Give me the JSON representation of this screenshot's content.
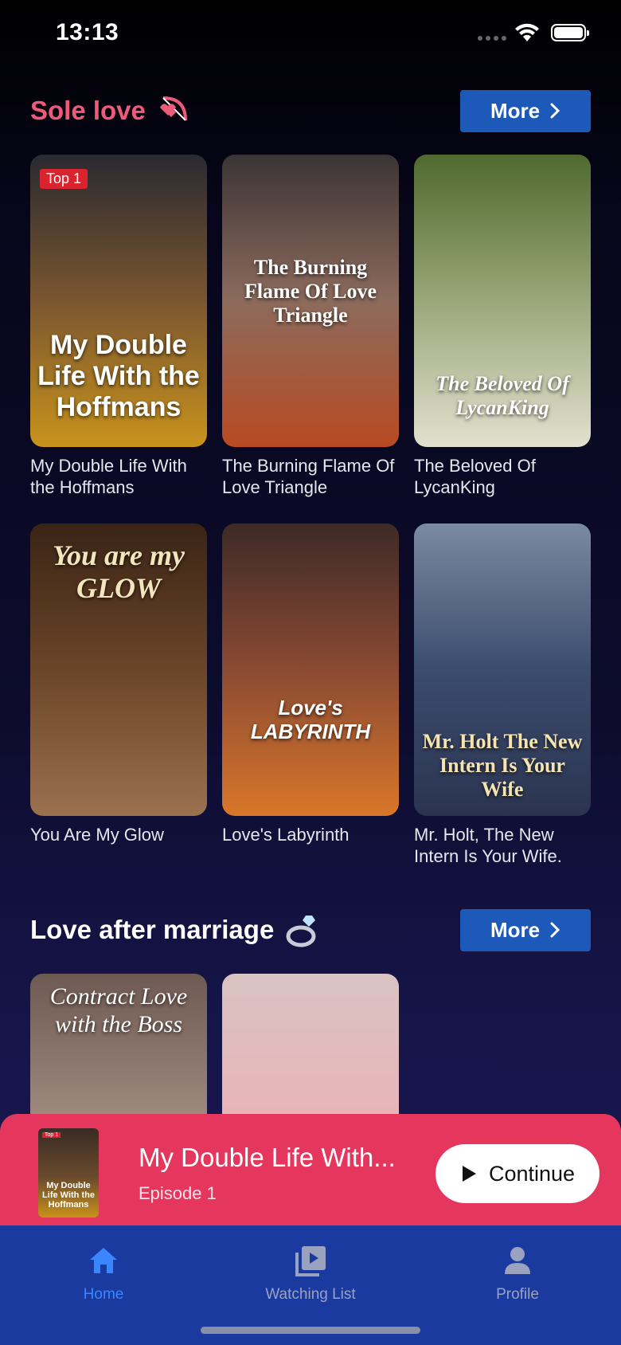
{
  "status_bar": {
    "time": "13:13"
  },
  "sections": [
    {
      "title": "Sole love",
      "icon": "cupid-bow-icon",
      "more_label": "More",
      "items": [
        {
          "title": "My Double Life With the Hoffmans",
          "poster_text": "My Double Life With the Hoffmans",
          "badge": "Top 1",
          "colors": [
            "#2a2a30",
            "#7a5630",
            "#c9931c"
          ]
        },
        {
          "title": "The Burning Flame Of Love Triangle",
          "poster_text": "The Burning Flame Of Love Triangle",
          "colors": [
            "#3b3436",
            "#8c6b5c",
            "#b84a22"
          ]
        },
        {
          "title": "The Beloved Of LycanKing",
          "poster_text": "The Beloved Of LycanKing",
          "colors": [
            "#4f6a2e",
            "#9aa779",
            "#e2e0cf"
          ]
        },
        {
          "title": "You Are My Glow",
          "poster_text": "You are my GLOW",
          "colors": [
            "#3a2416",
            "#6b4528",
            "#9b7150"
          ]
        },
        {
          "title": "Love's Labyrinth",
          "poster_text": "Love's LABYRINTH",
          "colors": [
            "#3e2a26",
            "#8a4a33",
            "#d9772a"
          ]
        },
        {
          "title": "Mr. Holt, The New Intern Is Your Wife.",
          "poster_text": "Mr. Holt The New Intern Is Your Wife",
          "colors": [
            "#7a8aa0",
            "#3c4c6e",
            "#2a3450"
          ]
        }
      ]
    },
    {
      "title": "Love after marriage",
      "icon": "ring-icon",
      "more_label": "More",
      "items": [
        {
          "title": "Contract Love with the Boss",
          "poster_text": "Contract Love with the Boss",
          "colors": [
            "#6e5a52",
            "#a08a80",
            "#d8c8c0"
          ]
        },
        {
          "title": "",
          "poster_text": "",
          "colors": [
            "#d9c3c3",
            "#e8b4b8",
            "#c23a3a"
          ]
        }
      ]
    }
  ],
  "mini_player": {
    "title": "My Double Life With...",
    "episode": "Episode 1",
    "continue_label": "Continue",
    "thumb_text": "My Double Life With the Hoffmans",
    "thumb_badge": "Top 1"
  },
  "tab_bar": {
    "items": [
      {
        "label": "Home",
        "icon": "home-icon",
        "active": true
      },
      {
        "label": "Watching List",
        "icon": "watching-list-icon",
        "active": false
      },
      {
        "label": "Profile",
        "icon": "profile-icon",
        "active": false
      }
    ]
  },
  "colors": {
    "accent_pink": "#ee5b7a",
    "more_button": "#1d59b8",
    "mini_player_bg": "#e5365d",
    "tab_bar_bg": "#1a3aa0",
    "tab_active": "#3a86ff"
  }
}
